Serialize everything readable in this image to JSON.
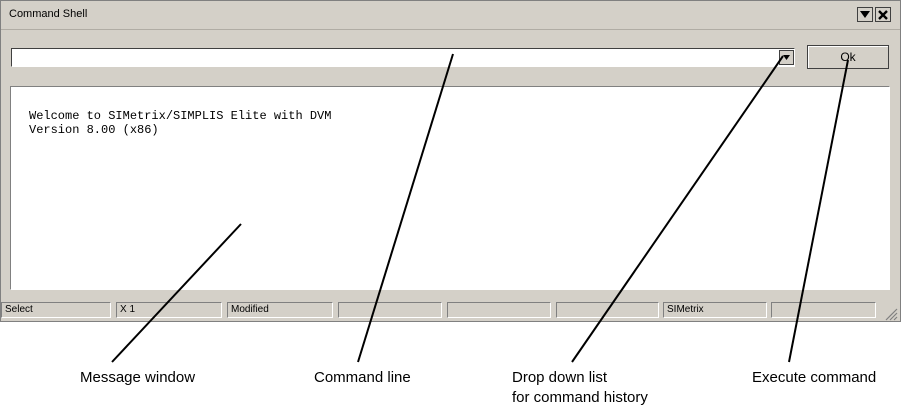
{
  "window": {
    "title": "Command Shell",
    "menu_icon": "dropdown-triangle-icon",
    "close_icon": "close-x-icon"
  },
  "command_bar": {
    "input_value": "",
    "ok_label": "Ok"
  },
  "message_window": {
    "lines": [
      "Welcome to SIMetrix/SIMPLIS Elite with DVM",
      "Version 8.00 (x86)"
    ]
  },
  "statusbar": {
    "cells": [
      "Select",
      "X 1",
      "Modified",
      "",
      "",
      "",
      "SIMetrix",
      ""
    ]
  },
  "callouts": {
    "message_window": "Message window",
    "command_line": "Command line",
    "drop_down_line1": "Drop down list",
    "drop_down_line2": "for command history",
    "execute": "Execute command"
  }
}
